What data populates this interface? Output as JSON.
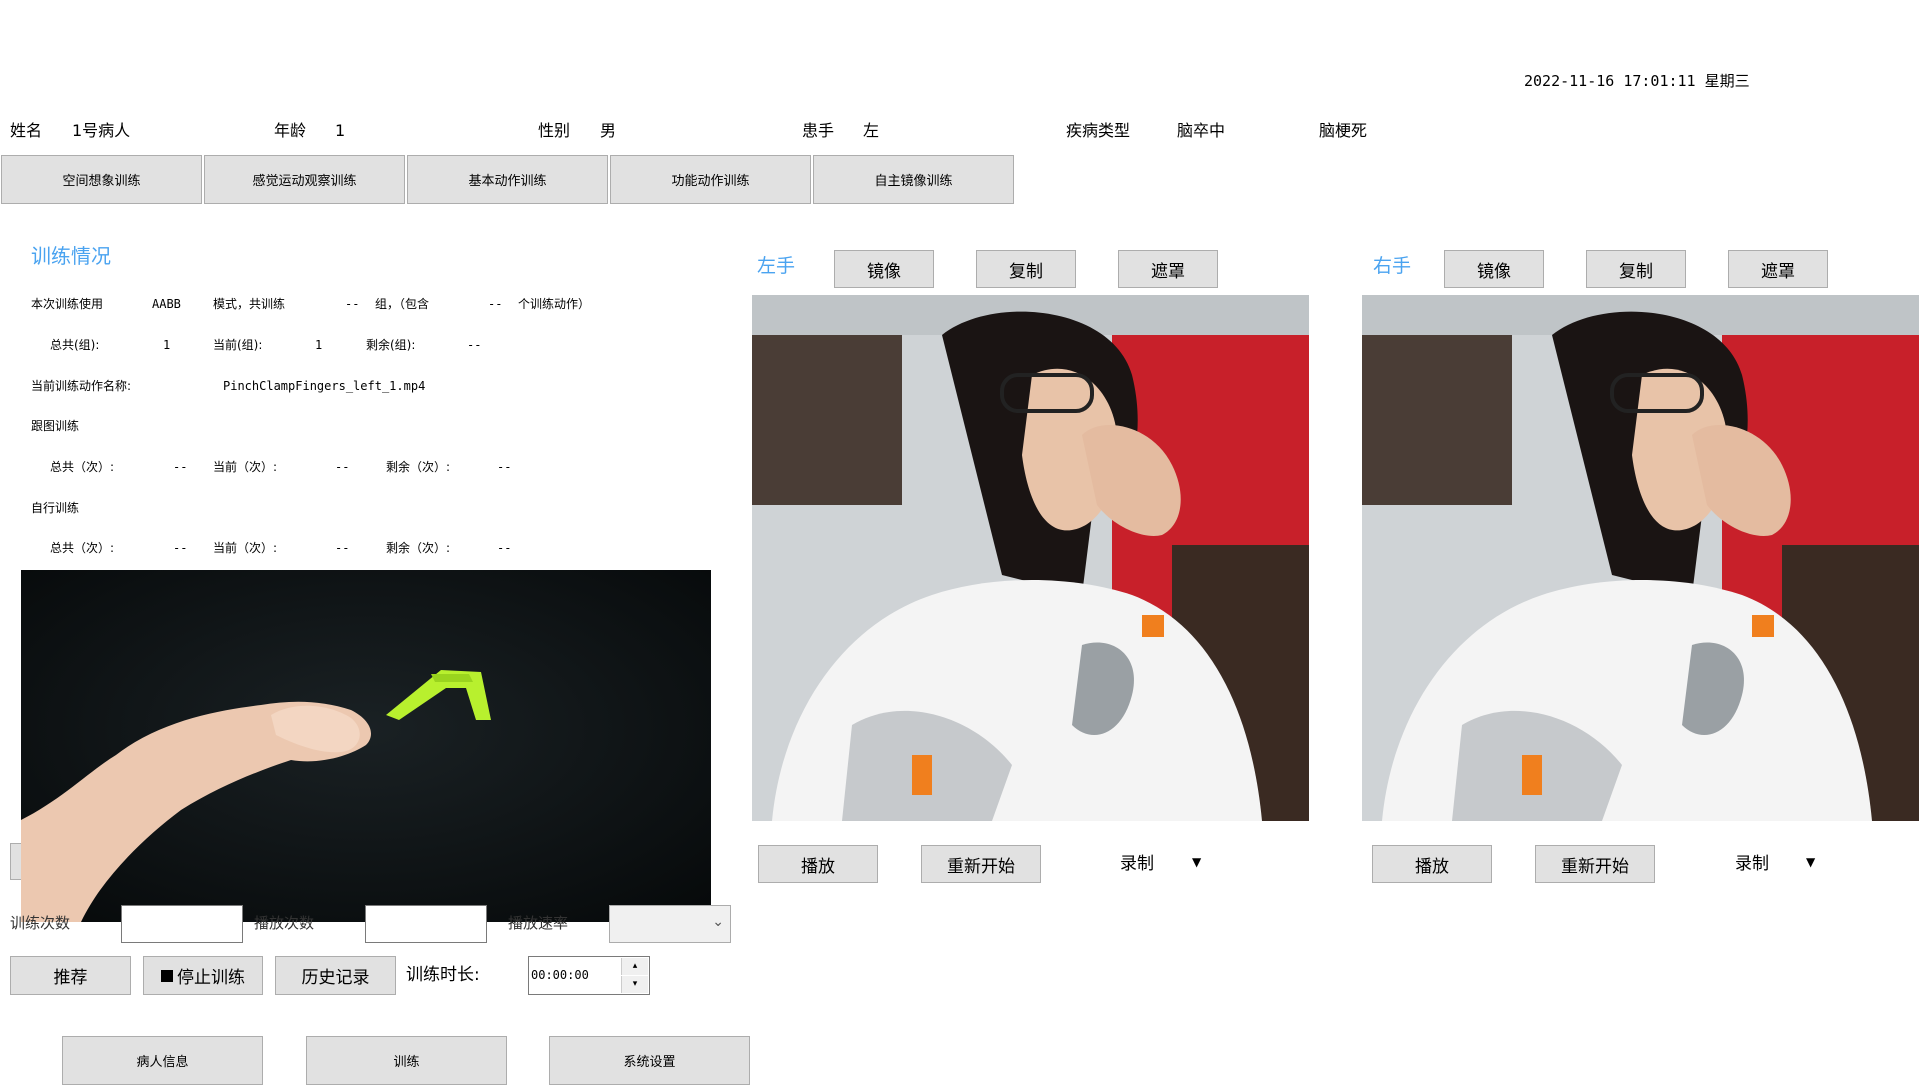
{
  "header": {
    "datetime": "2022-11-16  17:01:11  星期三"
  },
  "patient": {
    "name_label": "姓名",
    "name_value": "1号病人",
    "age_label": "年龄",
    "age_value": "1",
    "sex_label": "性别",
    "sex_value": "男",
    "hand_label": "患手",
    "hand_value": "左",
    "disease_label": "疾病类型",
    "disease_value": "脑卒中",
    "disease_sub": "脑梗死"
  },
  "tabs": [
    "空间想象训练",
    "感觉运动观察训练",
    "基本动作训练",
    "功能动作训练",
    "自主镜像训练"
  ],
  "training": {
    "title": "训练情况",
    "line1_a": "本次训练使用",
    "line1_mode": "AABB",
    "line1_b": "模式，共训练",
    "line1_groups": "--",
    "line1_c": "组，（包含",
    "line1_actions": "--",
    "line1_d": "个训练动作）",
    "group_total_label": "总共(组):",
    "group_total_value": "1",
    "group_current_label": "当前(组):",
    "group_current_value": "1",
    "group_left_label": "剩余(组):",
    "group_left_value": "--",
    "action_name_label": "当前训练动作名称:",
    "action_name_value": "PinchClampFingers_left_1.mp4",
    "follow_label": "跟图训练",
    "follow_total_label": "总共（次）:",
    "follow_total_value": "--",
    "follow_current_label": "当前（次）:",
    "follow_current_value": "--",
    "follow_left_label": "剩余（次）:",
    "follow_left_value": "--",
    "self_label": "自行训练",
    "self_total_label": "总共（次）:",
    "self_total_value": "--",
    "self_current_label": "当前（次）:",
    "self_current_value": "--",
    "self_left_label": "剩余（次）:",
    "self_left_value": "--"
  },
  "controls": {
    "train_count_label": "训练次数",
    "play_count_label": "播放次数",
    "play_speed_label": "播放速率",
    "recommend": "推荐",
    "stop": "停止训练",
    "history": "历史记录",
    "duration_label": "训练时长:",
    "duration_value": "00:00:00"
  },
  "left_panel": {
    "title": "左手",
    "mirror": "镜像",
    "copy": "复制",
    "mask": "遮罩",
    "play": "播放",
    "restart": "重新开始",
    "record": "录制"
  },
  "right_panel": {
    "title": "右手",
    "mirror": "镜像",
    "copy": "复制",
    "mask": "遮罩",
    "play": "播放",
    "restart": "重新开始",
    "record": "录制"
  },
  "bottom_nav": {
    "patient_info": "病人信息",
    "train": "训练",
    "settings": "系统设置"
  },
  "colors": {
    "accent": "#4aa3f0",
    "button_bg": "#e1e1e1"
  }
}
